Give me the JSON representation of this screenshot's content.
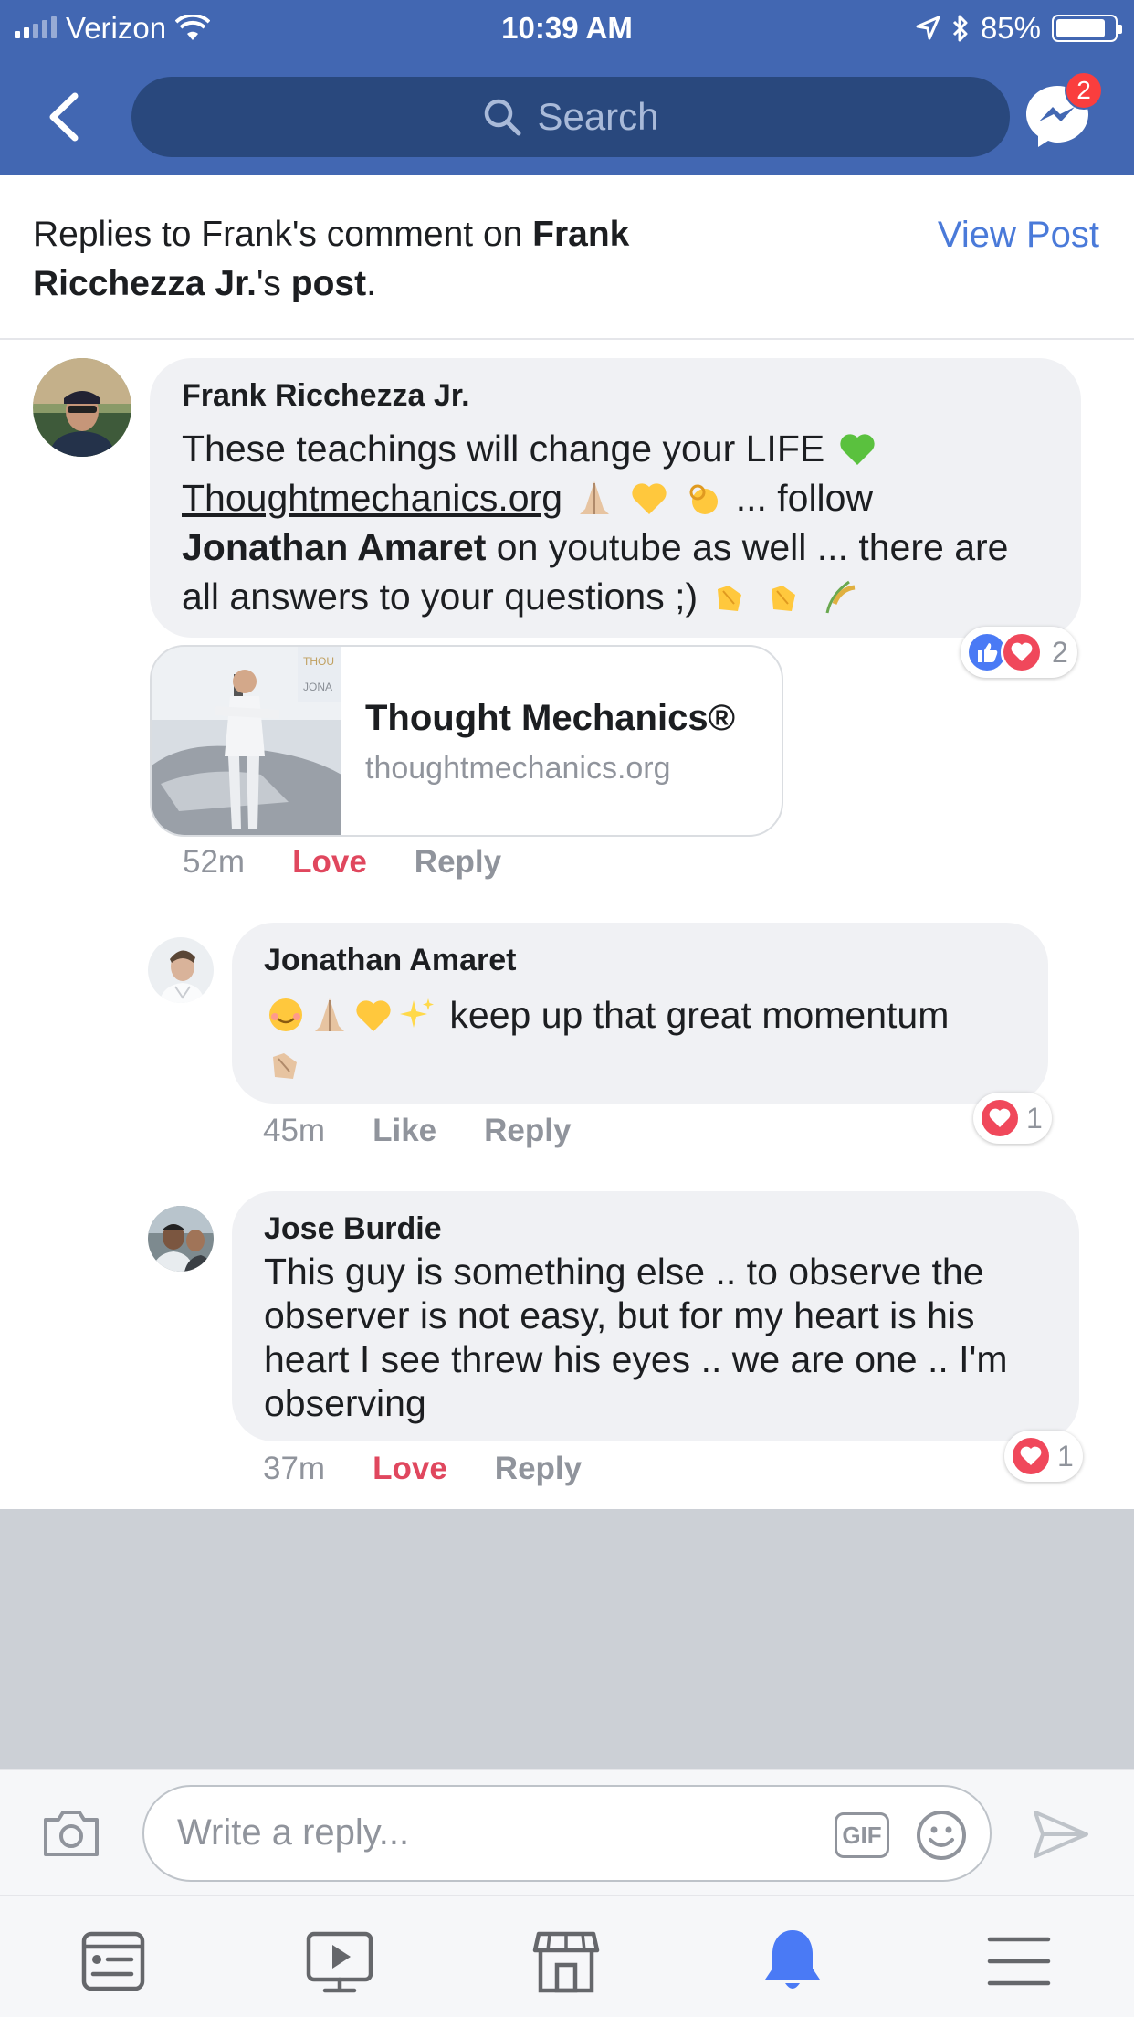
{
  "status_bar": {
    "carrier": "Verizon",
    "time": "10:39 AM",
    "battery": "85%",
    "battery_level": 0.85
  },
  "nav": {
    "search_placeholder": "Search",
    "messenger_badge": "2"
  },
  "header": {
    "prefix": "Replies to Frank's comment on ",
    "author": "Frank Ricchezza Jr.",
    "possessive": "'s ",
    "post_word": "post",
    "suffix": ".",
    "view_post": "View Post"
  },
  "main_comment": {
    "name": "Frank Ricchezza Jr.",
    "line1": "These teachings will change your LIFE",
    "link_text": "Thoughtmechanics.org",
    "line2_tail": " ... follow",
    "mention": "Jonathan Amaret",
    "line3_tail": " on youtube as well ... there are",
    "line4": "all answers to your questions ;)",
    "reaction_count": "2",
    "time": "52m",
    "action_love": "Love",
    "action_reply": "Reply",
    "link_card": {
      "title": "Thought Mechanics®",
      "domain": "thoughtmechanics.org"
    }
  },
  "replies": [
    {
      "name": "Jonathan Amaret",
      "text": "keep up that great momentum",
      "time": "45m",
      "action_like": "Like",
      "action_reply": "Reply",
      "reaction_count": "1"
    },
    {
      "name": "Jose Burdie",
      "text_lines": [
        "This guy is something else .. to observe the",
        "observer is not easy,  but for my heart is his",
        "heart I see threw his eyes .. we are one .. I'm",
        "observing"
      ],
      "time": "37m",
      "action_love": "Love",
      "action_reply": "Reply",
      "reaction_count": "1"
    }
  ],
  "composer": {
    "placeholder": "Write a reply...",
    "gif_label": "GIF"
  },
  "colors": {
    "brand_blue": "#4267b2",
    "love_red": "#e0475e",
    "link_blue": "#4a7ad9"
  }
}
